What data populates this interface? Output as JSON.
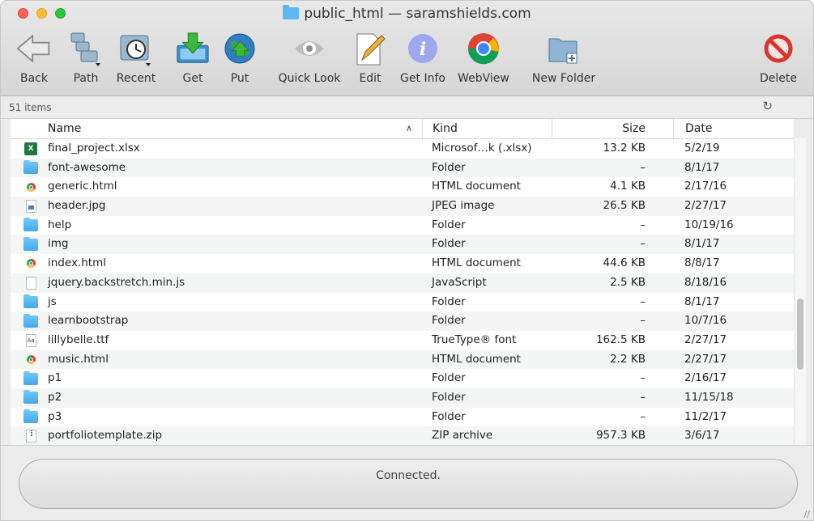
{
  "window": {
    "title": "public_html — saramshields.com"
  },
  "toolbar": {
    "back": "Back",
    "path": "Path",
    "recent": "Recent",
    "get": "Get",
    "put": "Put",
    "quick_look": "Quick Look",
    "edit": "Edit",
    "get_info": "Get Info",
    "webview": "WebView",
    "new_folder": "New Folder",
    "delete": "Delete"
  },
  "infobar": {
    "item_count": "51 items"
  },
  "columns": {
    "name": "Name",
    "kind": "Kind",
    "size": "Size",
    "date": "Date"
  },
  "files": [
    {
      "icon": "excel-file-icon",
      "name": "final_project.xlsx",
      "kind": "Microsof…k (.xlsx)",
      "size": "13.2 KB",
      "date": "5/2/19"
    },
    {
      "icon": "folder-icon",
      "name": "font-awesome",
      "kind": "Folder",
      "size": "–",
      "date": "8/1/17"
    },
    {
      "icon": "chrome-html-icon",
      "name": "generic.html",
      "kind": "HTML document",
      "size": "4.1 KB",
      "date": "2/17/16"
    },
    {
      "icon": "image-file-icon",
      "name": "header.jpg",
      "kind": "JPEG image",
      "size": "26.5 KB",
      "date": "2/27/17"
    },
    {
      "icon": "folder-icon",
      "name": "help",
      "kind": "Folder",
      "size": "–",
      "date": "10/19/16"
    },
    {
      "icon": "folder-icon",
      "name": "img",
      "kind": "Folder",
      "size": "–",
      "date": "8/1/17"
    },
    {
      "icon": "chrome-html-icon",
      "name": "index.html",
      "kind": "HTML document",
      "size": "44.6 KB",
      "date": "8/8/17"
    },
    {
      "icon": "blank-file-icon",
      "name": "jquery.backstretch.min.js",
      "kind": "JavaScript",
      "size": "2.5 KB",
      "date": "8/18/16"
    },
    {
      "icon": "folder-icon",
      "name": "js",
      "kind": "Folder",
      "size": "–",
      "date": "8/1/17"
    },
    {
      "icon": "folder-icon",
      "name": "learnbootstrap",
      "kind": "Folder",
      "size": "–",
      "date": "10/7/16"
    },
    {
      "icon": "font-file-icon",
      "name": "lillybelle.ttf",
      "kind": "TrueType® font",
      "size": "162.5 KB",
      "date": "2/27/17"
    },
    {
      "icon": "chrome-html-icon",
      "name": "music.html",
      "kind": "HTML document",
      "size": "2.2 KB",
      "date": "2/27/17"
    },
    {
      "icon": "folder-icon",
      "name": "p1",
      "kind": "Folder",
      "size": "–",
      "date": "2/16/17"
    },
    {
      "icon": "folder-icon",
      "name": "p2",
      "kind": "Folder",
      "size": "–",
      "date": "11/15/18"
    },
    {
      "icon": "folder-icon",
      "name": "p3",
      "kind": "Folder",
      "size": "–",
      "date": "11/2/17"
    },
    {
      "icon": "zip-file-icon",
      "name": "portfoliotemplate.zip",
      "kind": "ZIP archive",
      "size": "957.3 KB",
      "date": "3/6/17"
    }
  ],
  "status": {
    "text": "Connected."
  },
  "colors": {
    "folder": "#5cb8f0",
    "close": "#fe5f57",
    "minimize": "#febc2e",
    "zoom": "#28c840",
    "delete": "#d9352a"
  }
}
